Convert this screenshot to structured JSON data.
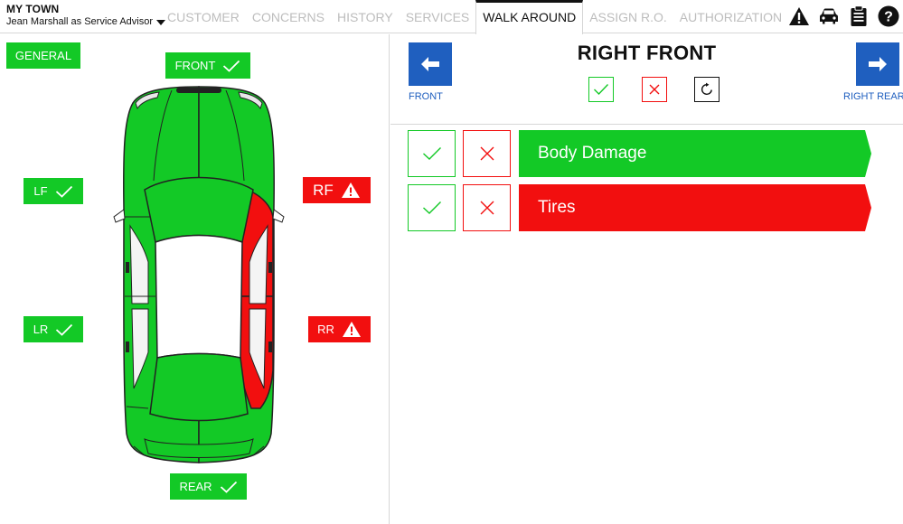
{
  "header": {
    "location": "MY TOWN",
    "user_role": "Jean Marshall as Service Advisor",
    "tabs": [
      "CUSTOMER",
      "CONCERNS",
      "HISTORY",
      "SERVICES",
      "WALK AROUND",
      "ASSIGN R.O.",
      "AUTHORIZATION"
    ],
    "active_tab": "WALK AROUND",
    "icons": [
      "warning-icon",
      "car-icon",
      "clipboard-icon",
      "help-icon"
    ]
  },
  "left": {
    "general_label": "GENERAL",
    "zones": {
      "front": {
        "label": "FRONT",
        "status": "ok"
      },
      "lf": {
        "label": "LF",
        "status": "ok"
      },
      "rf": {
        "label": "RF",
        "status": "warning"
      },
      "lr": {
        "label": "LR",
        "status": "ok"
      },
      "rr": {
        "label": "RR",
        "status": "warning"
      },
      "rear": {
        "label": "REAR",
        "status": "ok"
      }
    }
  },
  "right": {
    "title": "RIGHT FRONT",
    "prev": {
      "label": "FRONT",
      "icon": "arrow-left-icon"
    },
    "next": {
      "label": "RIGHT REAR",
      "icon": "arrow-right-icon"
    },
    "actions": [
      "check-icon",
      "close-icon",
      "refresh-icon"
    ],
    "items": [
      {
        "label": "Body Damage",
        "status": "ok"
      },
      {
        "label": "Tires",
        "status": "fail"
      }
    ]
  },
  "colors": {
    "ok": "#13c926",
    "fail": "#f20f0f",
    "accent": "#1f5fbf"
  }
}
